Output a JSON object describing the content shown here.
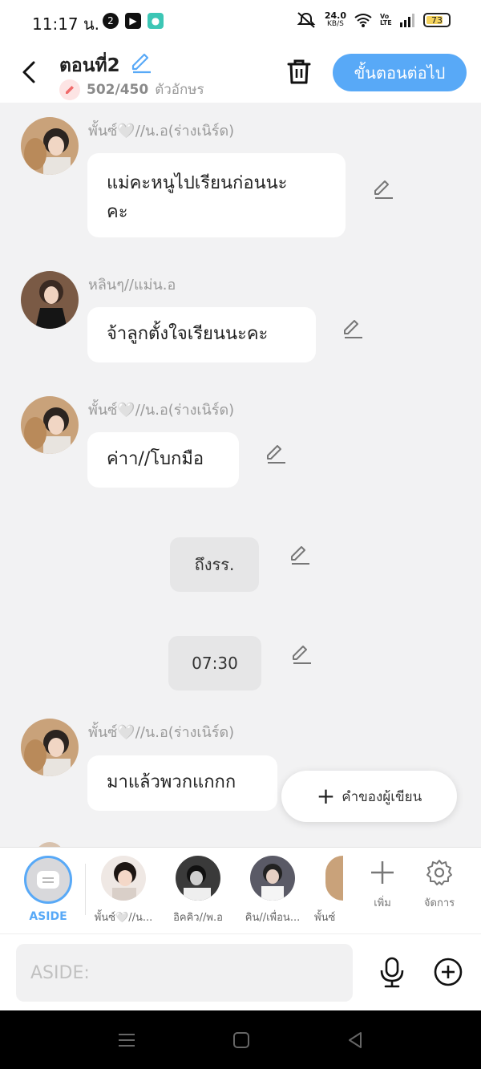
{
  "status_bar": {
    "time": "11:17 น.",
    "net_speed_value": "24.0",
    "net_speed_unit": "KB/S",
    "volte": "Vo LTE",
    "battery": "73"
  },
  "header": {
    "title": "ตอนที่2",
    "char_count": "502/450",
    "char_unit": "ตัวอักษร",
    "next_label": "ขั้นตอนต่อไป"
  },
  "messages": [
    {
      "type": "char",
      "speaker": "พั้นซ์🤍//น.อ(ร่างเนิร์ด)",
      "line1": "แม่คะหนูไปเรียนก่อนนะ",
      "line2": "คะ"
    },
    {
      "type": "char",
      "speaker": "หลินๆ//แม่น.อ",
      "line1": "จ้าลูกตั้งใจเรียนนะคะ"
    },
    {
      "type": "char",
      "speaker": "พั้นซ์🤍//น.อ(ร่างเนิร์ด)",
      "line1": "ค่าา//โบกมือ"
    },
    {
      "type": "narration",
      "text": "ถึงรร."
    },
    {
      "type": "narration",
      "text": "07:30"
    },
    {
      "type": "char",
      "speaker": "พั้นซ์🤍//น.อ(ร่างเนิร์ด)",
      "line1": "มาแล้วพวกแกกก"
    }
  ],
  "floating_button": {
    "label": "คำของผู้เขียน"
  },
  "character_bar": {
    "aside_label": "ASIDE",
    "characters": [
      {
        "name": "พั้นซ์🤍//น..."
      },
      {
        "name": "อิคคิว//พ.อ"
      },
      {
        "name": "คิน//เพื่อน..."
      },
      {
        "name": "พั้นซ์"
      }
    ],
    "add_label": "เพิ่ม",
    "manage_label": "จัดการ"
  },
  "input": {
    "placeholder": "ASIDE:"
  },
  "colors": {
    "accent": "#58a9f7",
    "chat_background": "#f2f2f3",
    "bubble": "#ffffff",
    "narration_bubble": "#e6e6e7"
  }
}
